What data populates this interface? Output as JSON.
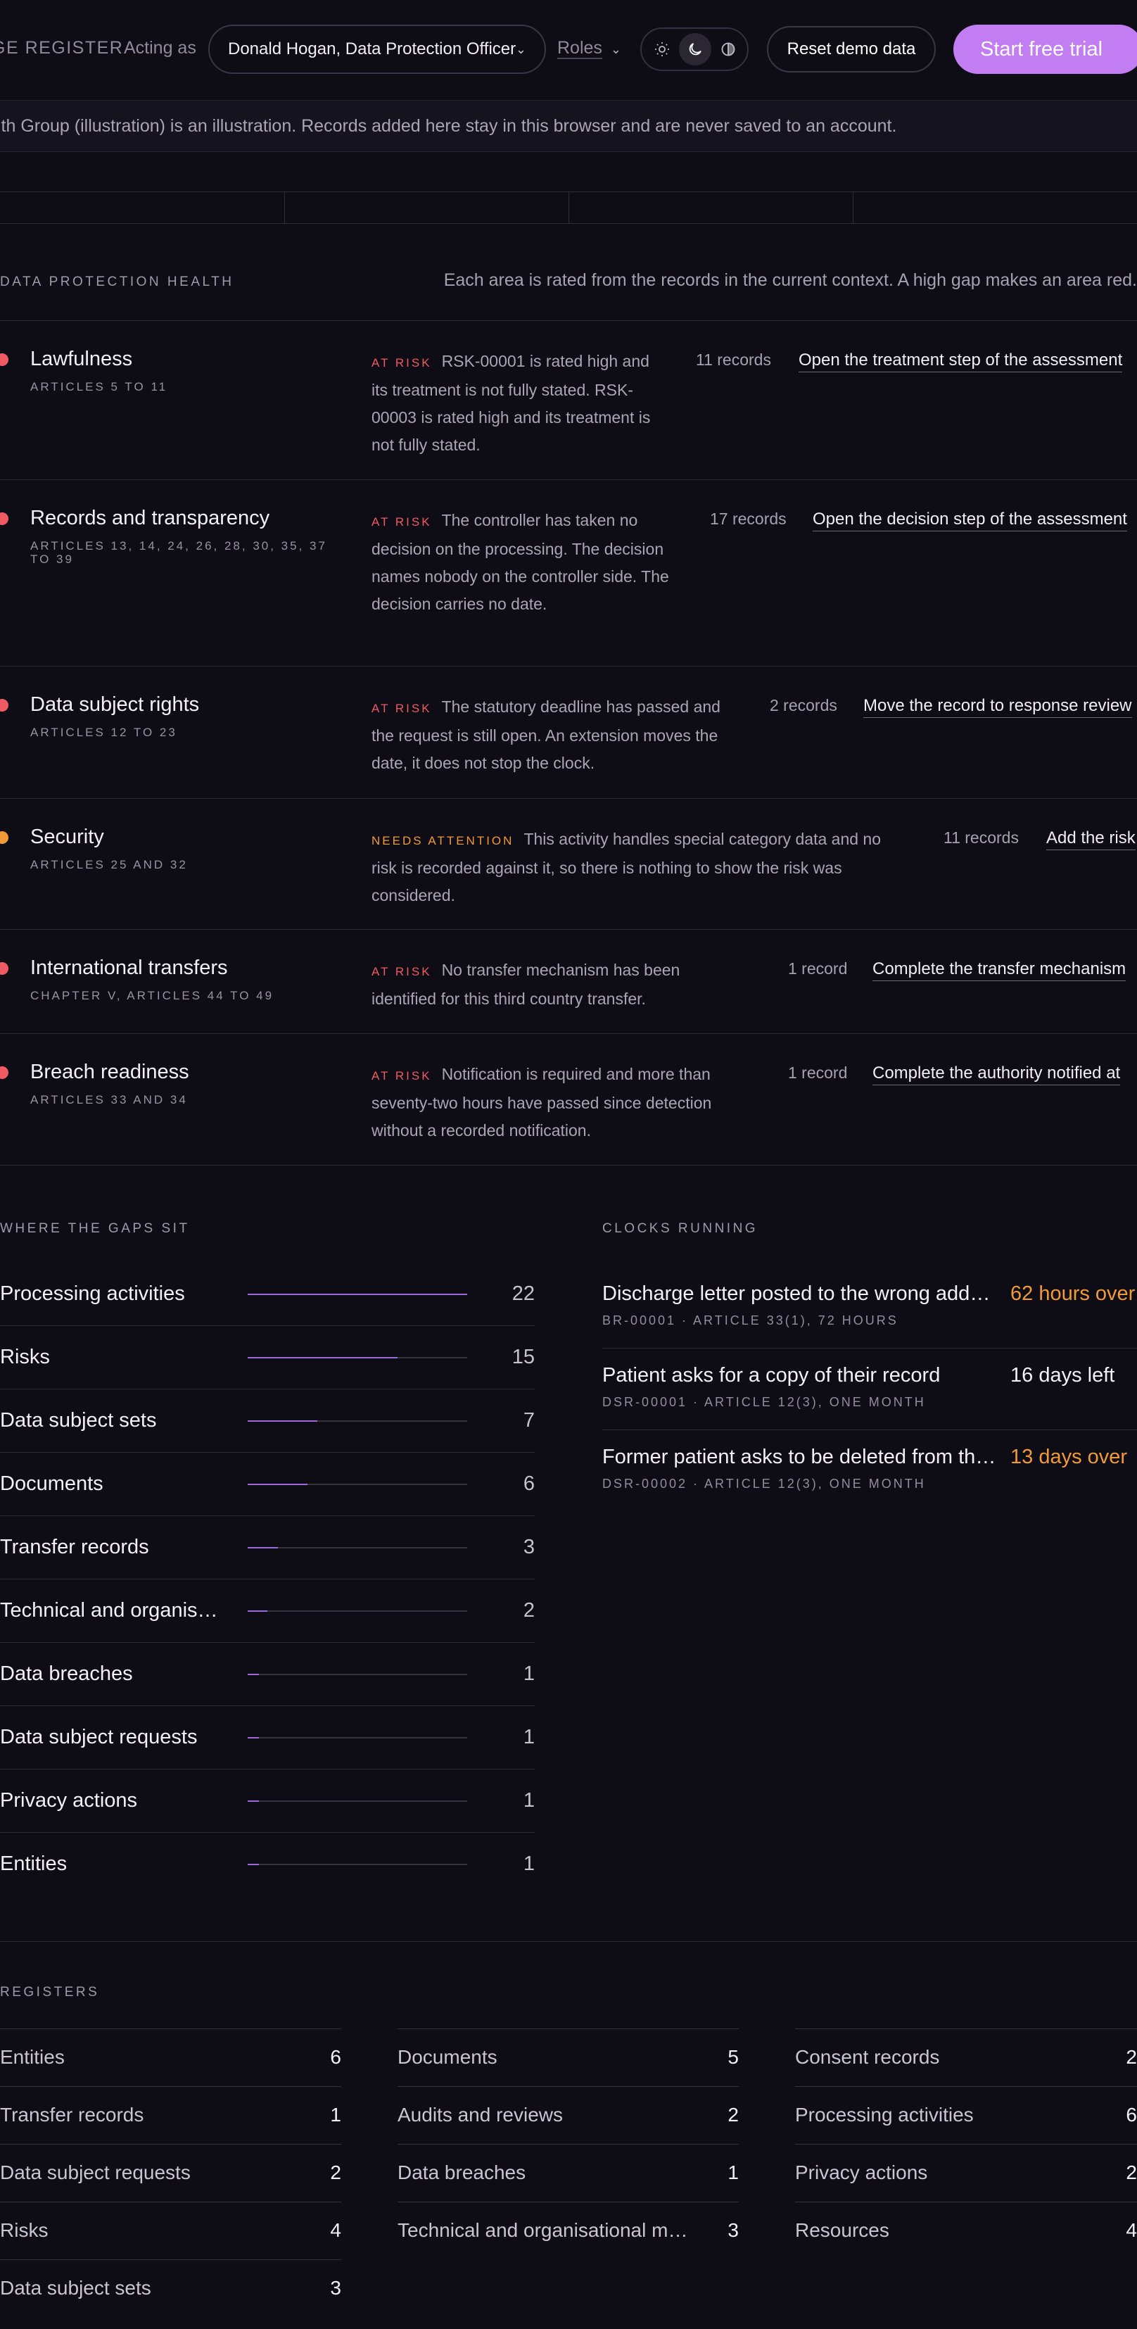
{
  "header": {
    "app_title": "GE REGISTER",
    "acting_as_label": "Acting as",
    "acting_as_value": "Donald Hogan, Data Protection Officer",
    "roles_label": "Roles",
    "reset_label": "Reset demo data",
    "trial_label": "Start free trial",
    "theme_icons": [
      "sun-icon",
      "moon-icon",
      "contrast-icon"
    ],
    "active_theme": "moon-icon"
  },
  "notice": {
    "text": "lth Group (illustration) is an illustration. Records added here stay in this browser and are never saved to an account."
  },
  "health": {
    "label": "DATA PROTECTION HEALTH",
    "description": "Each area is rated from the records in the current context. A high gap makes an area red.",
    "areas": [
      {
        "name": "Lawfulness",
        "articles": "ARTICLES 5 TO 11",
        "status": "AT RISK",
        "status_color": "#f05a63",
        "detail": "RSK-00001 is rated high and its treatment is not fully stated. RSK-00003 is rated high and its treatment is not fully stated.",
        "count": "11 records",
        "action": "Open the treatment step of the assessment"
      },
      {
        "name": "Records and transparency",
        "articles": "ARTICLES 13, 14, 24, 26, 28, 30, 35, 37 TO 39",
        "status": "AT RISK",
        "status_color": "#f05a63",
        "detail": "The controller has taken no decision on the processing. The decision names nobody on the controller side. The decision carries no date.",
        "count": "17 records",
        "action": "Open the decision step of the assessment"
      },
      {
        "name": "Data subject rights",
        "articles": "ARTICLES 12 TO 23",
        "status": "AT RISK",
        "status_color": "#f05a63",
        "detail": "The statutory deadline has passed and the request is still open. An extension moves the date, it does not stop the clock.",
        "count": "2 records",
        "action": "Move the record to response review"
      },
      {
        "name": "Security",
        "articles": "ARTICLES 25 AND 32",
        "status": "NEEDS ATTENTION",
        "status_color": "#f29a3a",
        "detail": "This activity handles special category data and no risk is recorded against it, so there is nothing to show the risk was considered.",
        "count": "11 records",
        "action": "Add the risk"
      },
      {
        "name": "International transfers",
        "articles": "CHAPTER V, ARTICLES 44 TO 49",
        "status": "AT RISK",
        "status_color": "#f05a63",
        "detail": "No transfer mechanism has been identified for this third country transfer.",
        "count": "1 record",
        "action": "Complete the transfer mechanism"
      },
      {
        "name": "Breach readiness",
        "articles": "ARTICLES 33 AND 34",
        "status": "AT RISK",
        "status_color": "#f05a63",
        "detail": "Notification is required and more than seventy-two hours have passed since detection without a recorded notification.",
        "count": "1 record",
        "action": "Complete the authority notified at"
      }
    ]
  },
  "gaps": {
    "label": "WHERE THE GAPS SIT",
    "max": 22,
    "items": [
      {
        "name": "Processing activities",
        "value": 22
      },
      {
        "name": "Risks",
        "value": 15
      },
      {
        "name": "Data subject sets",
        "value": 7
      },
      {
        "name": "Documents",
        "value": 6
      },
      {
        "name": "Transfer records",
        "value": 3
      },
      {
        "name": "Technical and organisational measures",
        "value": 2
      },
      {
        "name": "Data breaches",
        "value": 1
      },
      {
        "name": "Data subject requests",
        "value": 1
      },
      {
        "name": "Privacy actions",
        "value": 1
      },
      {
        "name": "Entities",
        "value": 1
      }
    ]
  },
  "clocks": {
    "label": "CLOCKS RUNNING",
    "items": [
      {
        "title": "Discharge letter posted to the wrong address",
        "meta": "BR-00001 · ARTICLE 33(1), 72 HOURS",
        "time": "62 hours over",
        "color": "#f29a3a"
      },
      {
        "title": "Patient asks for a copy of their record",
        "meta": "DSR-00001 · ARTICLE 12(3), ONE MONTH",
        "time": "16 days left",
        "color": "#f3f0f7"
      },
      {
        "title": "Former patient asks to be deleted from the register",
        "meta": "DSR-00002 · ARTICLE 12(3), ONE MONTH",
        "time": "13 days over",
        "color": "#f29a3a"
      }
    ]
  },
  "registers": {
    "label": "REGISTERS",
    "columns": [
      [
        {
          "name": "Entities",
          "count": "6"
        },
        {
          "name": "Transfer records",
          "count": "1"
        },
        {
          "name": "Data subject requests",
          "count": "2"
        },
        {
          "name": "Risks",
          "count": "4"
        },
        {
          "name": "Data subject sets",
          "count": "3"
        }
      ],
      [
        {
          "name": "Documents",
          "count": "5"
        },
        {
          "name": "Audits and reviews",
          "count": "2"
        },
        {
          "name": "Data breaches",
          "count": "1"
        },
        {
          "name": "Technical and organisational measures",
          "count": "3"
        }
      ],
      [
        {
          "name": "Consent records",
          "count": "2"
        },
        {
          "name": "Processing activities",
          "count": "6"
        },
        {
          "name": "Privacy actions",
          "count": "2"
        },
        {
          "name": "Resources",
          "count": "4"
        }
      ]
    ]
  }
}
